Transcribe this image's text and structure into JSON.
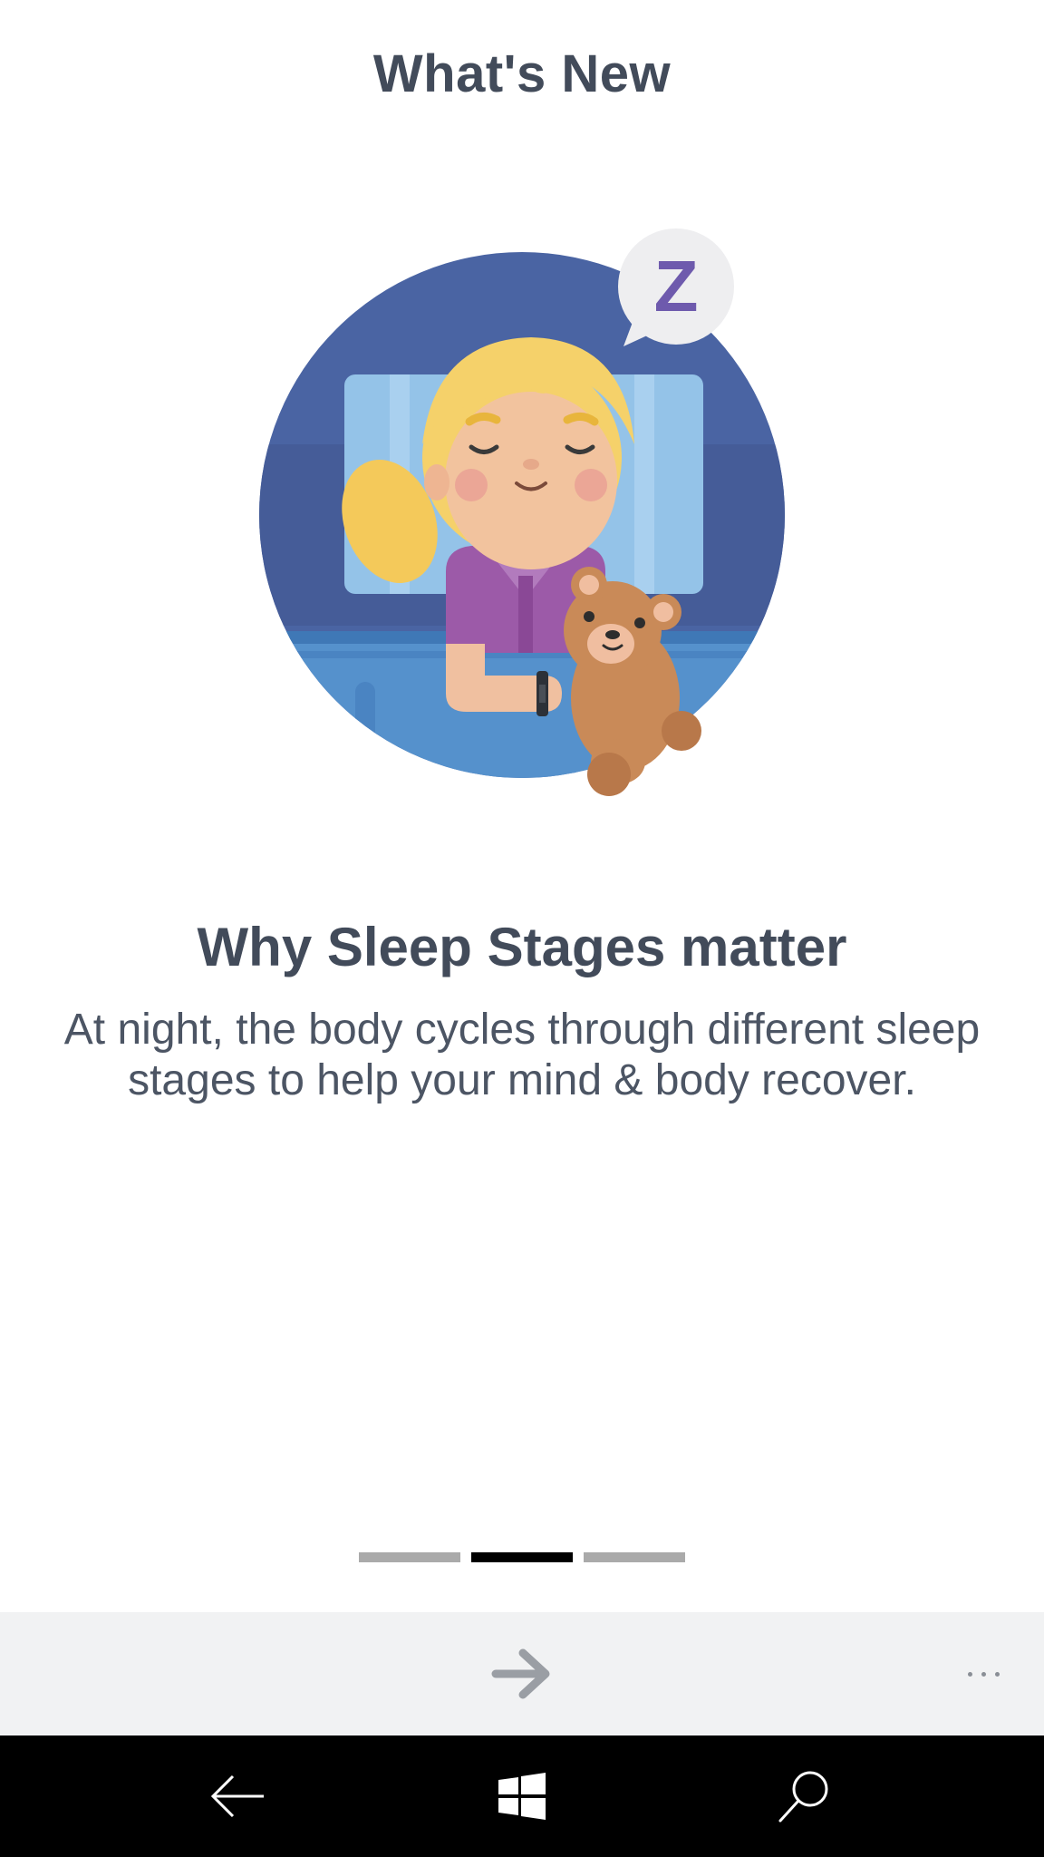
{
  "header": {
    "title": "What's New"
  },
  "illustration": {
    "icon": "sleeping-girl-with-teddy-bear-illustration",
    "bubble_letter": "Z"
  },
  "content": {
    "headline": "Why Sleep Stages matter",
    "body": "At night, the body cycles through different sleep stages to help your mind & body recover."
  },
  "pager": {
    "pages": 3,
    "active_index": 1
  },
  "app_bar": {
    "next_icon": "arrow-right-icon",
    "more_icon": "more-options-icon"
  },
  "nav_bar": {
    "back_icon": "back-arrow-icon",
    "home_icon": "windows-logo-icon",
    "search_icon": "search-icon"
  },
  "colors": {
    "text": "#424b5a",
    "app_bar_bg": "#f1f2f3",
    "pager_inactive": "#aaaaaa",
    "pager_active": "#000000",
    "circle_bg": "#4a64a3"
  }
}
